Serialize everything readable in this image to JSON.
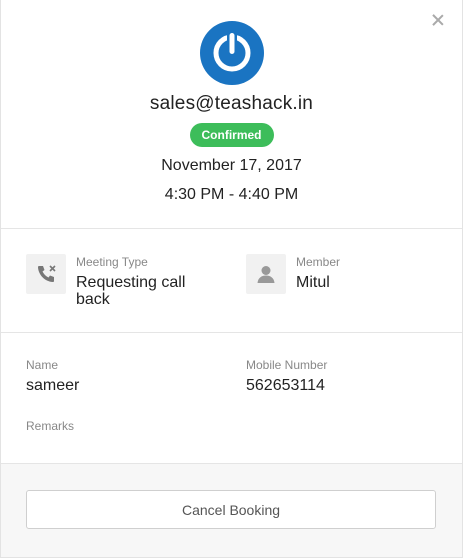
{
  "header": {
    "logo_icon": "power-logo-icon",
    "email": "sales@teashack.in",
    "status": "Confirmed",
    "status_color": "#3dbd5a",
    "date": "November 17, 2017",
    "time": "4:30 PM - 4:40 PM",
    "brand_color": "#1a74c2"
  },
  "meeting": {
    "type_label": "Meeting Type",
    "type_value": "Requesting call back",
    "type_icon": "phone-icon",
    "member_label": "Member",
    "member_value": "Mitul",
    "member_icon": "user-icon"
  },
  "details": {
    "name_label": "Name",
    "name_value": "sameer",
    "mobile_label": "Mobile Number",
    "mobile_value": "562653114",
    "remarks_label": "Remarks"
  },
  "footer": {
    "cancel_label": "Cancel Booking"
  }
}
